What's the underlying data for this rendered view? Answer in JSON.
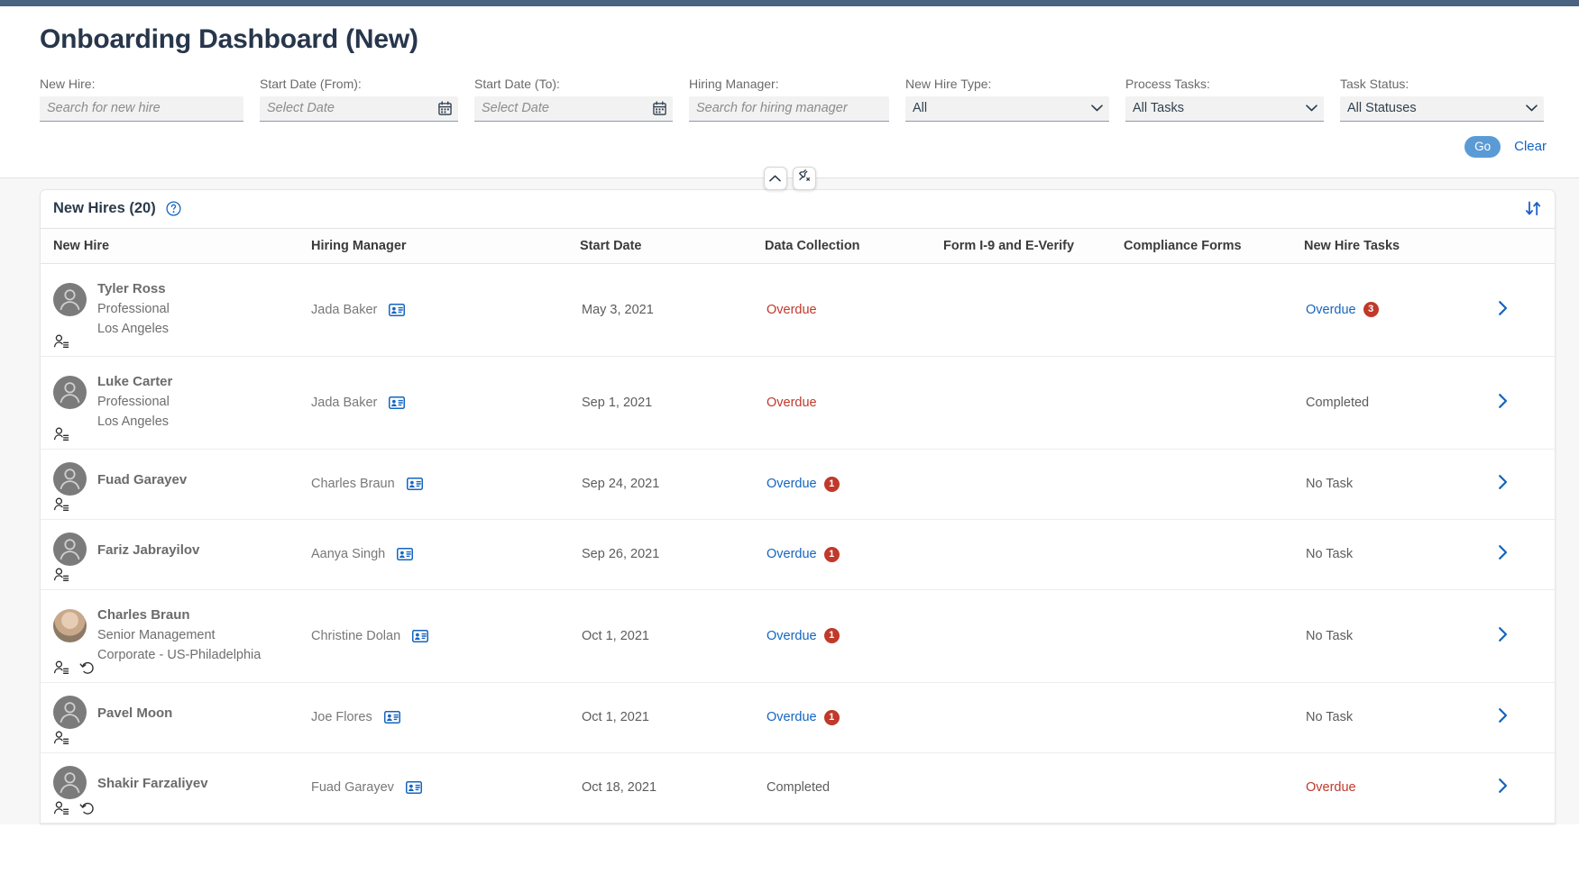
{
  "page": {
    "title": "Onboarding Dashboard (New)"
  },
  "colors": {
    "accent_blue": "#1565c0",
    "go_button": "#5b9bd5",
    "overdue_red": "#c0392b",
    "title_navy": "#27364b",
    "top_strip": "#4a6380"
  },
  "filters": {
    "new_hire": {
      "label": "New Hire:",
      "placeholder": "Search for new hire",
      "value": ""
    },
    "start_date_from": {
      "label": "Start Date (From):",
      "placeholder": "Select Date",
      "value": "",
      "icon": "calendar-icon"
    },
    "start_date_to": {
      "label": "Start Date (To):",
      "placeholder": "Select Date",
      "value": "",
      "icon": "calendar-icon"
    },
    "hiring_manager": {
      "label": "Hiring Manager:",
      "placeholder": "Search for hiring manager",
      "value": ""
    },
    "new_hire_type": {
      "label": "New Hire Type:",
      "value": "All",
      "options": [
        "All"
      ]
    },
    "process_tasks": {
      "label": "Process Tasks:",
      "value": "All Tasks",
      "options": [
        "All Tasks"
      ]
    },
    "task_status": {
      "label": "Task Status:",
      "value": "All Statuses",
      "options": [
        "All Statuses"
      ]
    },
    "go_label": "Go",
    "clear_label": "Clear"
  },
  "toolbar": {
    "collapse_icon": "chevron-up-icon",
    "pin_icon": "unpin-icon"
  },
  "table": {
    "title": "New Hires (20)",
    "help_icon": "help-circle-icon",
    "sort_icon": "sort-arrows-icon",
    "columns": [
      "New Hire",
      "Hiring Manager",
      "Start Date",
      "Data Collection",
      "Form I-9 and E-Verify",
      "Compliance Forms",
      "New Hire Tasks"
    ],
    "rows": [
      {
        "name": "Tyler Ross",
        "role": "Professional",
        "location": "Los Angeles",
        "avatar_type": "silhouette",
        "row_icons": [
          "person-list-icon"
        ],
        "manager": "Jada Baker",
        "manager_icon": "contact-card-icon",
        "start_date": "May 3, 2021",
        "data_collection": {
          "text": "Overdue",
          "style": "red",
          "badge": ""
        },
        "form_i9": {
          "text": "",
          "style": "gray",
          "badge": ""
        },
        "compliance": {
          "text": "",
          "style": "gray",
          "badge": ""
        },
        "new_hire_tasks": {
          "text": "Overdue",
          "style": "link",
          "badge": "3"
        },
        "chevron": "chevron-right-icon"
      },
      {
        "name": "Luke Carter",
        "role": "Professional",
        "location": "Los Angeles",
        "avatar_type": "silhouette",
        "row_icons": [
          "person-list-icon"
        ],
        "manager": "Jada Baker",
        "manager_icon": "contact-card-icon",
        "start_date": "Sep 1, 2021",
        "data_collection": {
          "text": "Overdue",
          "style": "red",
          "badge": ""
        },
        "form_i9": {
          "text": "",
          "style": "gray",
          "badge": ""
        },
        "compliance": {
          "text": "",
          "style": "gray",
          "badge": ""
        },
        "new_hire_tasks": {
          "text": "Completed",
          "style": "gray",
          "badge": ""
        },
        "chevron": "chevron-right-icon"
      },
      {
        "name": "Fuad Garayev",
        "role": "",
        "location": "",
        "avatar_type": "silhouette",
        "row_icons": [
          "person-list-icon"
        ],
        "manager": "Charles Braun",
        "manager_icon": "contact-card-icon",
        "start_date": "Sep 24, 2021",
        "data_collection": {
          "text": "Overdue",
          "style": "link",
          "badge": "1"
        },
        "form_i9": {
          "text": "",
          "style": "gray",
          "badge": ""
        },
        "compliance": {
          "text": "",
          "style": "gray",
          "badge": ""
        },
        "new_hire_tasks": {
          "text": "No Task",
          "style": "gray",
          "badge": ""
        },
        "chevron": "chevron-right-icon"
      },
      {
        "name": "Fariz Jabrayilov",
        "role": "",
        "location": "",
        "avatar_type": "silhouette",
        "row_icons": [
          "person-list-icon"
        ],
        "manager": "Aanya Singh",
        "manager_icon": "contact-card-icon",
        "start_date": "Sep 26, 2021",
        "data_collection": {
          "text": "Overdue",
          "style": "link",
          "badge": "1"
        },
        "form_i9": {
          "text": "",
          "style": "gray",
          "badge": ""
        },
        "compliance": {
          "text": "",
          "style": "gray",
          "badge": ""
        },
        "new_hire_tasks": {
          "text": "No Task",
          "style": "gray",
          "badge": ""
        },
        "chevron": "chevron-right-icon"
      },
      {
        "name": "Charles Braun",
        "role": "Senior Management",
        "location": "Corporate - US-Philadelphia",
        "avatar_type": "photo",
        "row_icons": [
          "person-list-icon",
          "rehire-history-icon"
        ],
        "manager": "Christine Dolan",
        "manager_icon": "contact-card-icon",
        "start_date": "Oct 1, 2021",
        "data_collection": {
          "text": "Overdue",
          "style": "link",
          "badge": "1"
        },
        "form_i9": {
          "text": "",
          "style": "gray",
          "badge": ""
        },
        "compliance": {
          "text": "",
          "style": "gray",
          "badge": ""
        },
        "new_hire_tasks": {
          "text": "No Task",
          "style": "gray",
          "badge": ""
        },
        "chevron": "chevron-right-icon"
      },
      {
        "name": "Pavel Moon",
        "role": "",
        "location": "",
        "avatar_type": "silhouette",
        "row_icons": [
          "person-list-icon"
        ],
        "manager": "Joe Flores",
        "manager_icon": "contact-card-icon",
        "start_date": "Oct 1, 2021",
        "data_collection": {
          "text": "Overdue",
          "style": "link",
          "badge": "1"
        },
        "form_i9": {
          "text": "",
          "style": "gray",
          "badge": ""
        },
        "compliance": {
          "text": "",
          "style": "gray",
          "badge": ""
        },
        "new_hire_tasks": {
          "text": "No Task",
          "style": "gray",
          "badge": ""
        },
        "chevron": "chevron-right-icon"
      },
      {
        "name": "Shakir Farzaliyev",
        "role": "",
        "location": "",
        "avatar_type": "silhouette",
        "row_icons": [
          "person-list-icon",
          "rehire-history-icon"
        ],
        "manager": "Fuad Garayev",
        "manager_icon": "contact-card-icon",
        "start_date": "Oct 18, 2021",
        "data_collection": {
          "text": "Completed",
          "style": "gray",
          "badge": ""
        },
        "form_i9": {
          "text": "",
          "style": "gray",
          "badge": ""
        },
        "compliance": {
          "text": "",
          "style": "gray",
          "badge": ""
        },
        "new_hire_tasks": {
          "text": "Overdue",
          "style": "red",
          "badge": ""
        },
        "chevron": "chevron-right-icon"
      }
    ]
  }
}
